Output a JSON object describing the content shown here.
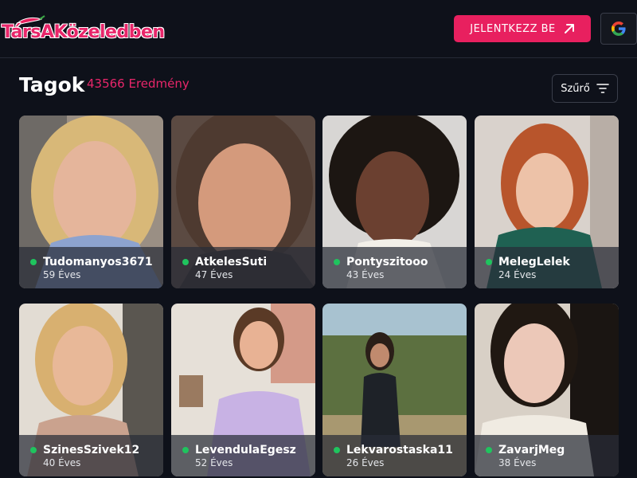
{
  "header": {
    "logo_text": "TársAKözeledben",
    "login_label": "JELENTKEZZ BE",
    "login_icon": "arrow-up-right-icon",
    "google_icon": "google-icon"
  },
  "main": {
    "title": "Tagok",
    "result_count": "43566 Eredmény",
    "filter_label": "Szűrő",
    "filter_icon": "filter-lines-icon"
  },
  "members": [
    {
      "name": "Tudomanyos3671",
      "age": "59 Éves",
      "online": true
    },
    {
      "name": "AtkelesSuti",
      "age": "47 Éves",
      "online": true
    },
    {
      "name": "Pontyszitooo",
      "age": "43 Éves",
      "online": true
    },
    {
      "name": "MelegLelek",
      "age": "24 Éves",
      "online": true
    },
    {
      "name": "SzinesSzivek12",
      "age": "40 Éves",
      "online": true
    },
    {
      "name": "LevendulaEgesz",
      "age": "52 Éves",
      "online": true
    },
    {
      "name": "Lekvarostaska11",
      "age": "26 Éves",
      "online": true
    },
    {
      "name": "ZavarjMeg",
      "age": "38 Éves",
      "online": true
    }
  ],
  "colors": {
    "background": "#0e111a",
    "accent": "#e8205f",
    "online": "#1fc45e"
  }
}
